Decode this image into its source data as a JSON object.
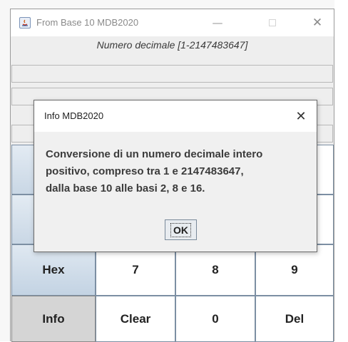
{
  "background_window": {
    "title": "From Base 10 MDB2020",
    "hint": "Numero decimale [1-2147483647]",
    "controls": {
      "minimize": "—",
      "maximize": "□",
      "close": "✕"
    },
    "keypad": {
      "row_hex": [
        "Hex",
        "7",
        "8",
        "9"
      ],
      "row_info": [
        "Info",
        "Clear",
        "0",
        "Del"
      ]
    }
  },
  "dialog": {
    "title": "Info MDB2020",
    "close": "✕",
    "message_lines": [
      "Conversione di un numero decimale intero",
      "positivo, compreso tra 1 e 2147483647,",
      "dalla base 10 alle basi 2, 8 e 16."
    ],
    "ok_label": "OK"
  },
  "icons": [
    "java-app-icon",
    "minimize-icon",
    "maximize-icon",
    "close-icon"
  ],
  "colors": {
    "side_key": "#c9d7e5",
    "info_key": "#d5d5d5",
    "window_bg": "#eeeeee"
  }
}
